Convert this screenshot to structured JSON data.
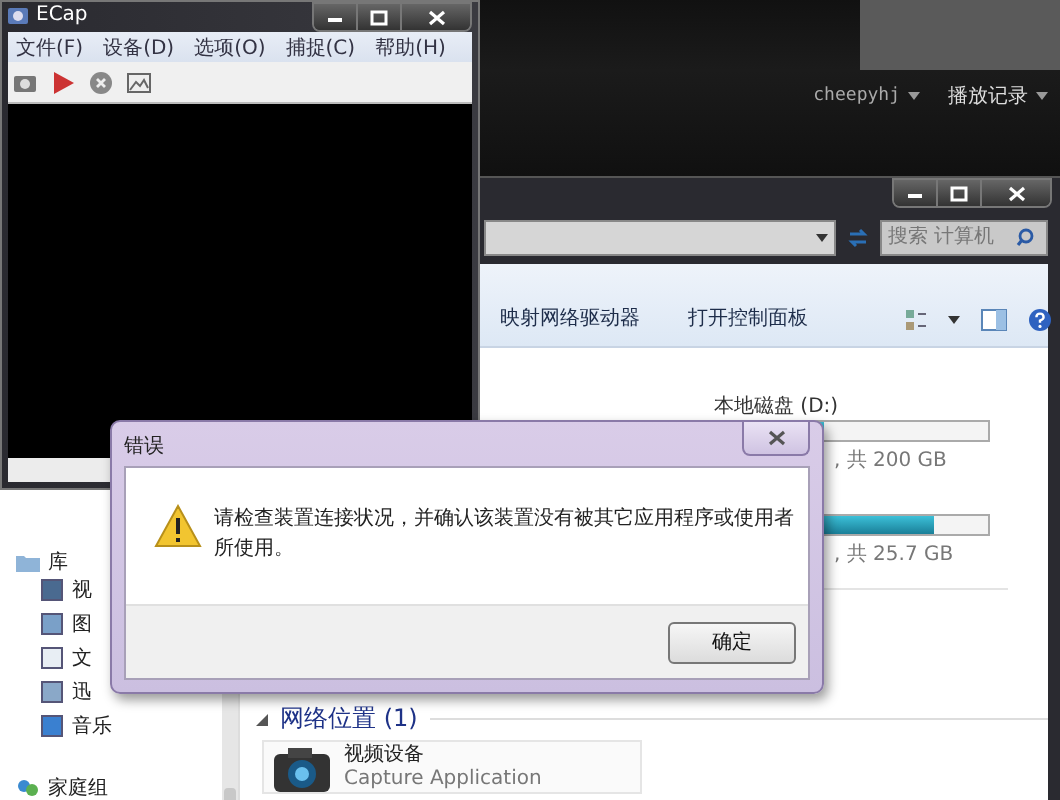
{
  "media_window": {
    "user": "cheepyhj",
    "history": "播放记录"
  },
  "explorer": {
    "search": {
      "placeholder": "搜索 计算机"
    },
    "toolbar": [
      "映射网络驱动器",
      "打开控制面板"
    ],
    "nav": [
      {
        "label": "库",
        "children": [
          {
            "label": "视"
          },
          {
            "label": "图"
          },
          {
            "label": "文"
          },
          {
            "label": "迅"
          },
          {
            "label": "音乐"
          }
        ]
      },
      {
        "label": "家庭组"
      }
    ],
    "drives": [
      {
        "name": "本地磁盘 (D:)",
        "level": 0.4,
        "info": ", 共 200 GB"
      },
      {
        "level": 0.8,
        "info": ", 共 25.7 GB"
      }
    ],
    "network": {
      "title": "网络位置 (1)",
      "items": [
        {
          "name": "视频设备",
          "subtitle": "Capture Application"
        }
      ]
    }
  },
  "ecap": {
    "title": "ECap",
    "menu": [
      "文件(F)",
      "设备(D)",
      "选项(O)",
      "捕捉(C)",
      "帮助(H)"
    ]
  },
  "dialog": {
    "title": "错误",
    "message": "请检查装置连接状况，并确认该装置没有被其它应用程序或使用者所使用。",
    "button": "确定"
  }
}
